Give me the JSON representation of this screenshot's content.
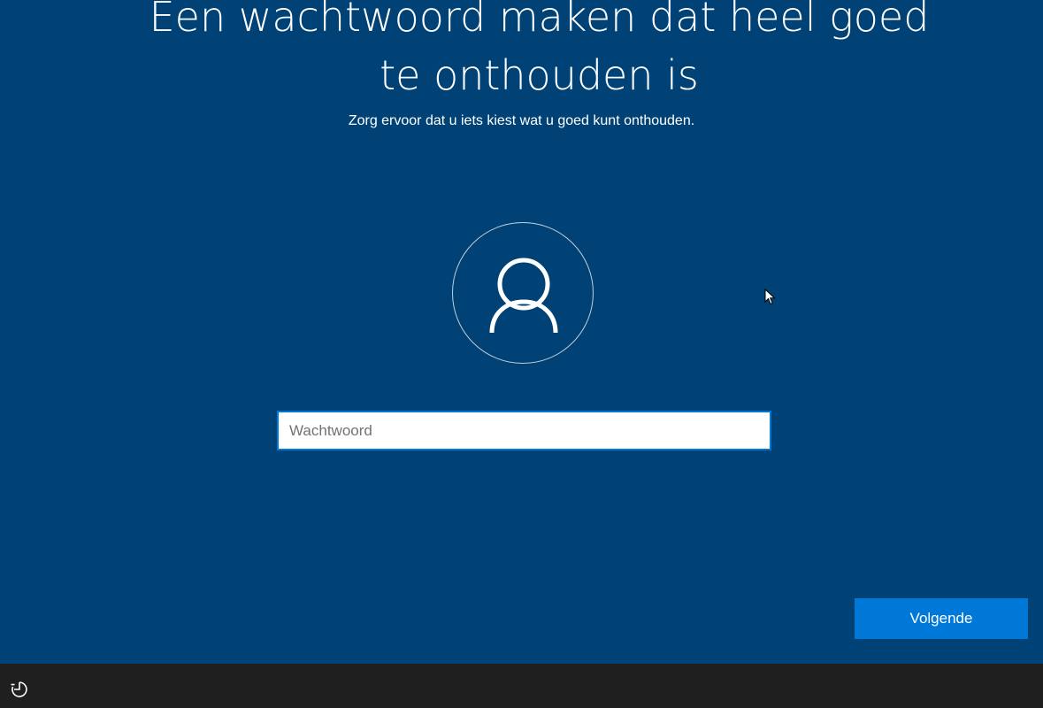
{
  "page": {
    "title": "Een wachtwoord maken dat heel goed te onthouden is",
    "subtitle": "Zorg ervoor dat u iets kiest wat u goed kunt onthouden."
  },
  "avatar": {
    "icon": "user-icon"
  },
  "password": {
    "placeholder": "Wachtwoord",
    "value": ""
  },
  "actions": {
    "next_label": "Volgende"
  },
  "taskbar": {
    "icon": "accessibility-icon"
  },
  "colors": {
    "background": "#004275",
    "accent": "#0078d7",
    "taskbar": "#1f1f1f",
    "text": "#ffffff"
  }
}
